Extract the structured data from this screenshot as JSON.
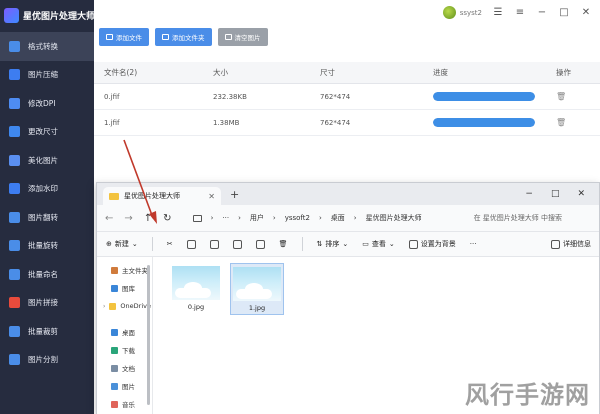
{
  "app": {
    "title": "星优图片处理大师",
    "user_name": "ssyst2"
  },
  "sidebar": {
    "items": [
      {
        "label": "格式转换",
        "color": "#4a8de8"
      },
      {
        "label": "图片压缩",
        "color": "#3d7df0"
      },
      {
        "label": "修改DPI",
        "color": "#4e8cf2"
      },
      {
        "label": "更改尺寸",
        "color": "#3f88ee"
      },
      {
        "label": "美化图片",
        "color": "#5a8ff0"
      },
      {
        "label": "添加水印",
        "color": "#3d7df0"
      },
      {
        "label": "图片翻转",
        "color": "#4a8de8"
      },
      {
        "label": "批量旋转",
        "color": "#4a8de8"
      },
      {
        "label": "批量命名",
        "color": "#4a8de8"
      },
      {
        "label": "图片拼接",
        "color": "#e84b3c"
      },
      {
        "label": "批量裁剪",
        "color": "#4a8de8"
      },
      {
        "label": "图片分割",
        "color": "#4a8de8"
      }
    ]
  },
  "toolbar": {
    "add_file": "添加文件",
    "add_folder": "添加文件夹",
    "clear": "清空图片"
  },
  "table": {
    "headers": [
      "文件名(2)",
      "大小",
      "尺寸",
      "进度",
      "操作"
    ],
    "rows": [
      {
        "name": "0.jfif",
        "size": "232.38KB",
        "dims": "762*474",
        "progress": 1.0
      },
      {
        "name": "1.jfif",
        "size": "1.38MB",
        "dims": "762*474",
        "progress": 1.0
      }
    ]
  },
  "explorer": {
    "tab_title": "星优图片处理大师",
    "breadcrumb": [
      "用户",
      "yssoft2",
      "桌面",
      "星优图片处理大师"
    ],
    "search_placeholder": "在 星优图片处理大师 中搜索",
    "commands": {
      "new": "新建",
      "sort": "排序",
      "view": "查看",
      "set_bg": "设置为背景",
      "details": "详细信息"
    },
    "sidebar": [
      "主文件夹",
      "图库",
      "OneDrive",
      "桌面",
      "下载",
      "文档",
      "图片",
      "音乐"
    ],
    "files": [
      {
        "name": "0.jpg",
        "selected": false
      },
      {
        "name": "1.jpg",
        "selected": true
      }
    ]
  },
  "watermark": "风行手游网"
}
